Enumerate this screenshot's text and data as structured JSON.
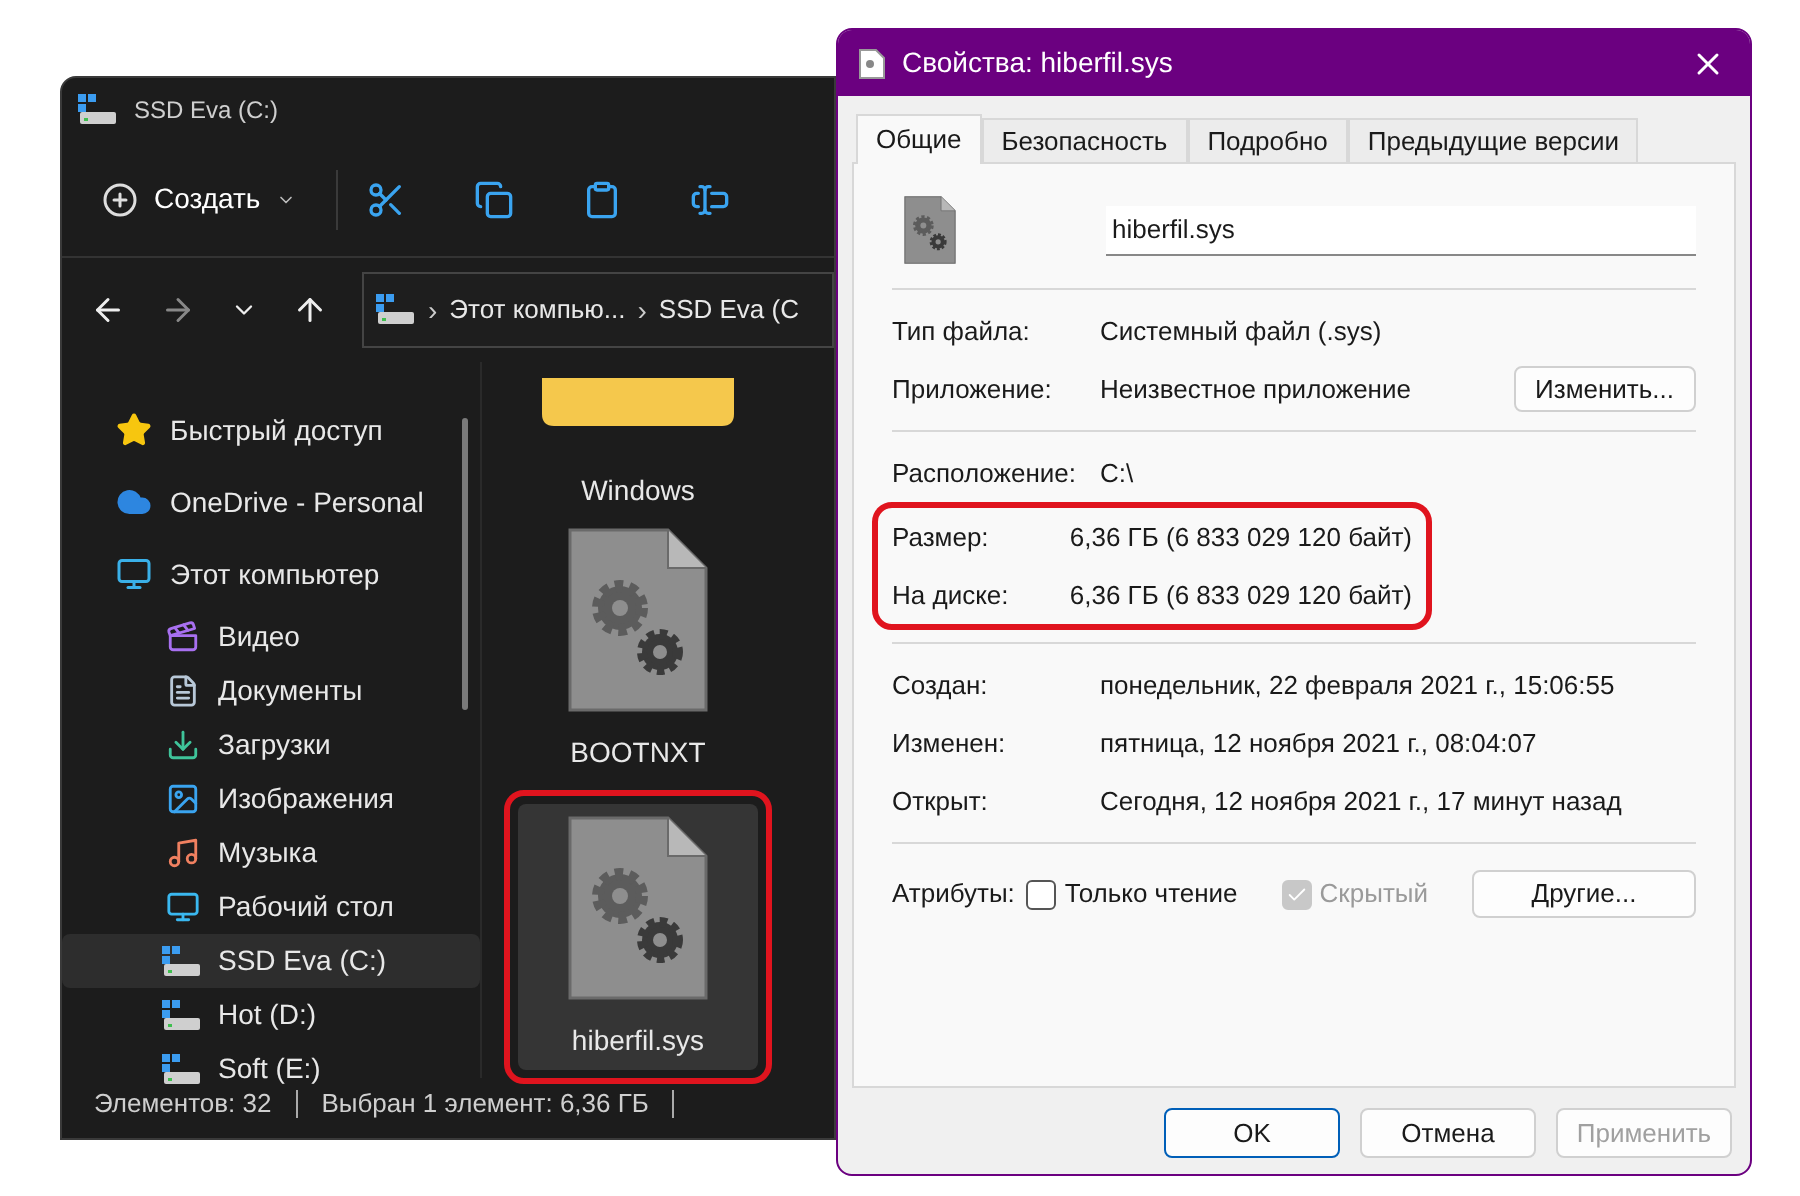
{
  "explorer": {
    "title": "SSD Eva (C:)",
    "toolbar": {
      "create_label": "Создать"
    },
    "address": {
      "separator": "›",
      "crumbs": [
        "Этот компью...",
        "SSD Eva (C"
      ]
    },
    "sidebar": {
      "items": [
        {
          "label": "Быстрый доступ",
          "selected": false
        },
        {
          "label": "OneDrive - Personal",
          "selected": false
        },
        {
          "label": "Этот компьютер",
          "selected": false,
          "children": [
            {
              "label": "Видео",
              "selected": false
            },
            {
              "label": "Документы",
              "selected": false
            },
            {
              "label": "Загрузки",
              "selected": false
            },
            {
              "label": "Изображения",
              "selected": false
            },
            {
              "label": "Музыка",
              "selected": false
            },
            {
              "label": "Рабочий стол",
              "selected": false
            },
            {
              "label": "SSD Eva (C:)",
              "selected": true
            },
            {
              "label": "Hot (D:)",
              "selected": false
            },
            {
              "label": "Soft (E:)",
              "selected": false
            }
          ]
        }
      ]
    },
    "files": [
      {
        "name": "Windows",
        "kind": "folder",
        "selected": false,
        "highlighted": false
      },
      {
        "name": "BOOTNXT",
        "kind": "system-file",
        "selected": false,
        "highlighted": false
      },
      {
        "name": "hiberfil.sys",
        "kind": "system-file",
        "selected": true,
        "highlighted": true
      }
    ],
    "status_bar": [
      "Элементов: 32",
      "Выбран 1 элемент: 6,36 ГБ"
    ]
  },
  "dialog": {
    "title": "Свойства: hiberfil.sys",
    "tabs": [
      {
        "label": "Общие",
        "selected": true
      },
      {
        "label": "Безопасность",
        "selected": false
      },
      {
        "label": "Подробно",
        "selected": false
      },
      {
        "label": "Предыдущие версии",
        "selected": false
      }
    ],
    "file_name": "hiberfil.sys",
    "sections": [
      [
        {
          "label": "Тип файла:",
          "value": "Системный файл (.sys)"
        },
        {
          "label": "Приложение:",
          "value": "Неизвестное приложение",
          "button": "Изменить..."
        }
      ],
      [
        {
          "label": "Расположение:",
          "value": "C:\\"
        },
        {
          "label": "Размер:",
          "value": "6,36 ГБ (6 833 029 120 байт)",
          "highlighted": true
        },
        {
          "label": "На диске:",
          "value": "6,36 ГБ (6 833 029 120 байт)",
          "highlighted": true
        }
      ],
      [
        {
          "label": "Создан:",
          "value": "понедельник, 22 февраля 2021 г., 15:06:55"
        },
        {
          "label": "Изменен:",
          "value": "пятница, 12 ноября 2021 г., 08:04:07"
        },
        {
          "label": "Открыт:",
          "value": "Сегодня, 12 ноября 2021 г., 17 минут назад"
        }
      ]
    ],
    "attributes": {
      "label": "Атрибуты:",
      "checkboxes": [
        {
          "label": "Только чтение",
          "checked": false,
          "disabled": false
        },
        {
          "label": "Скрытый",
          "checked": true,
          "disabled": true
        }
      ],
      "button": "Другие..."
    },
    "buttons": [
      {
        "label": "OK",
        "default": true,
        "disabled": false
      },
      {
        "label": "Отмена",
        "default": false,
        "disabled": false
      },
      {
        "label": "Применить",
        "default": false,
        "disabled": true
      }
    ]
  }
}
